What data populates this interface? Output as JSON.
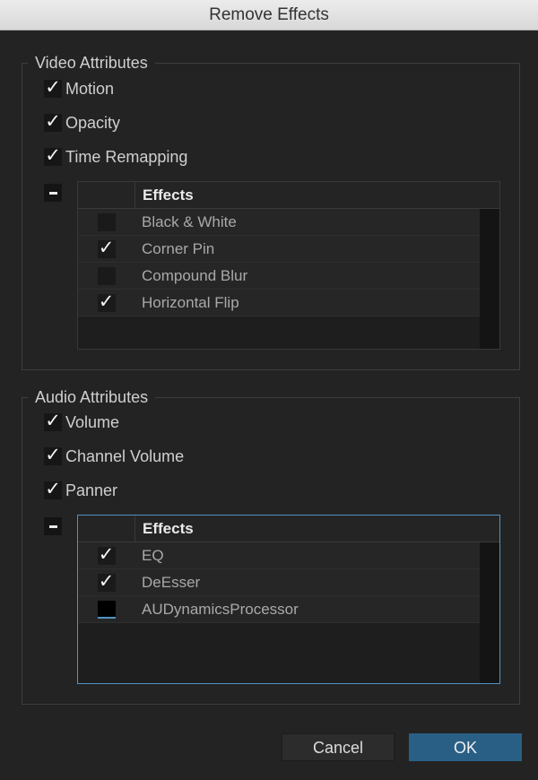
{
  "window": {
    "title": "Remove Effects"
  },
  "video": {
    "title": "Video Attributes",
    "options": [
      {
        "label": "Motion",
        "checked": true
      },
      {
        "label": "Opacity",
        "checked": true
      },
      {
        "label": "Time Remapping",
        "checked": true
      }
    ],
    "effects_header": "Effects",
    "effects": [
      {
        "label": "Black & White",
        "checked": false
      },
      {
        "label": "Corner Pin",
        "checked": true
      },
      {
        "label": "Compound Blur",
        "checked": false
      },
      {
        "label": "Horizontal Flip",
        "checked": true
      }
    ]
  },
  "audio": {
    "title": "Audio Attributes",
    "options": [
      {
        "label": "Volume",
        "checked": true
      },
      {
        "label": "Channel Volume",
        "checked": true
      },
      {
        "label": "Panner",
        "checked": true
      }
    ],
    "effects_header": "Effects",
    "effects": [
      {
        "label": "EQ",
        "checked": true
      },
      {
        "label": "DeEsser",
        "checked": true
      },
      {
        "label": "AUDynamicsProcessor",
        "checked": false
      }
    ]
  },
  "buttons": {
    "cancel": "Cancel",
    "ok": "OK"
  },
  "check_glyph": "✓",
  "colors": {
    "accent": "#2a5f85",
    "focus_border": "#4e93c6",
    "background": "#232323"
  }
}
